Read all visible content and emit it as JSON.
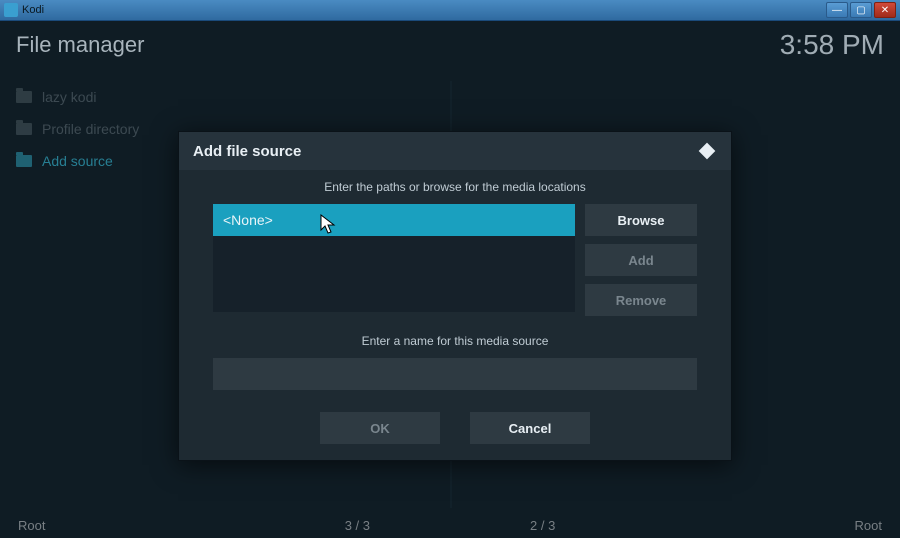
{
  "window": {
    "title": "Kodi"
  },
  "header": {
    "title": "File manager",
    "time": "3:58 PM"
  },
  "sidebar": {
    "items": [
      {
        "label": "lazy kodi"
      },
      {
        "label": "Profile directory"
      },
      {
        "label": "Add source"
      }
    ]
  },
  "dialog": {
    "title": "Add file source",
    "prompt_paths": "Enter the paths or browse for the media locations",
    "path_value": "<None>",
    "browse_label": "Browse",
    "add_label": "Add",
    "remove_label": "Remove",
    "prompt_name": "Enter a name for this media source",
    "name_value": "",
    "ok_label": "OK",
    "cancel_label": "Cancel"
  },
  "bottom": {
    "left_root": "Root",
    "count_left": "3 / 3",
    "count_right": "2 / 3",
    "right_root": "Root"
  }
}
